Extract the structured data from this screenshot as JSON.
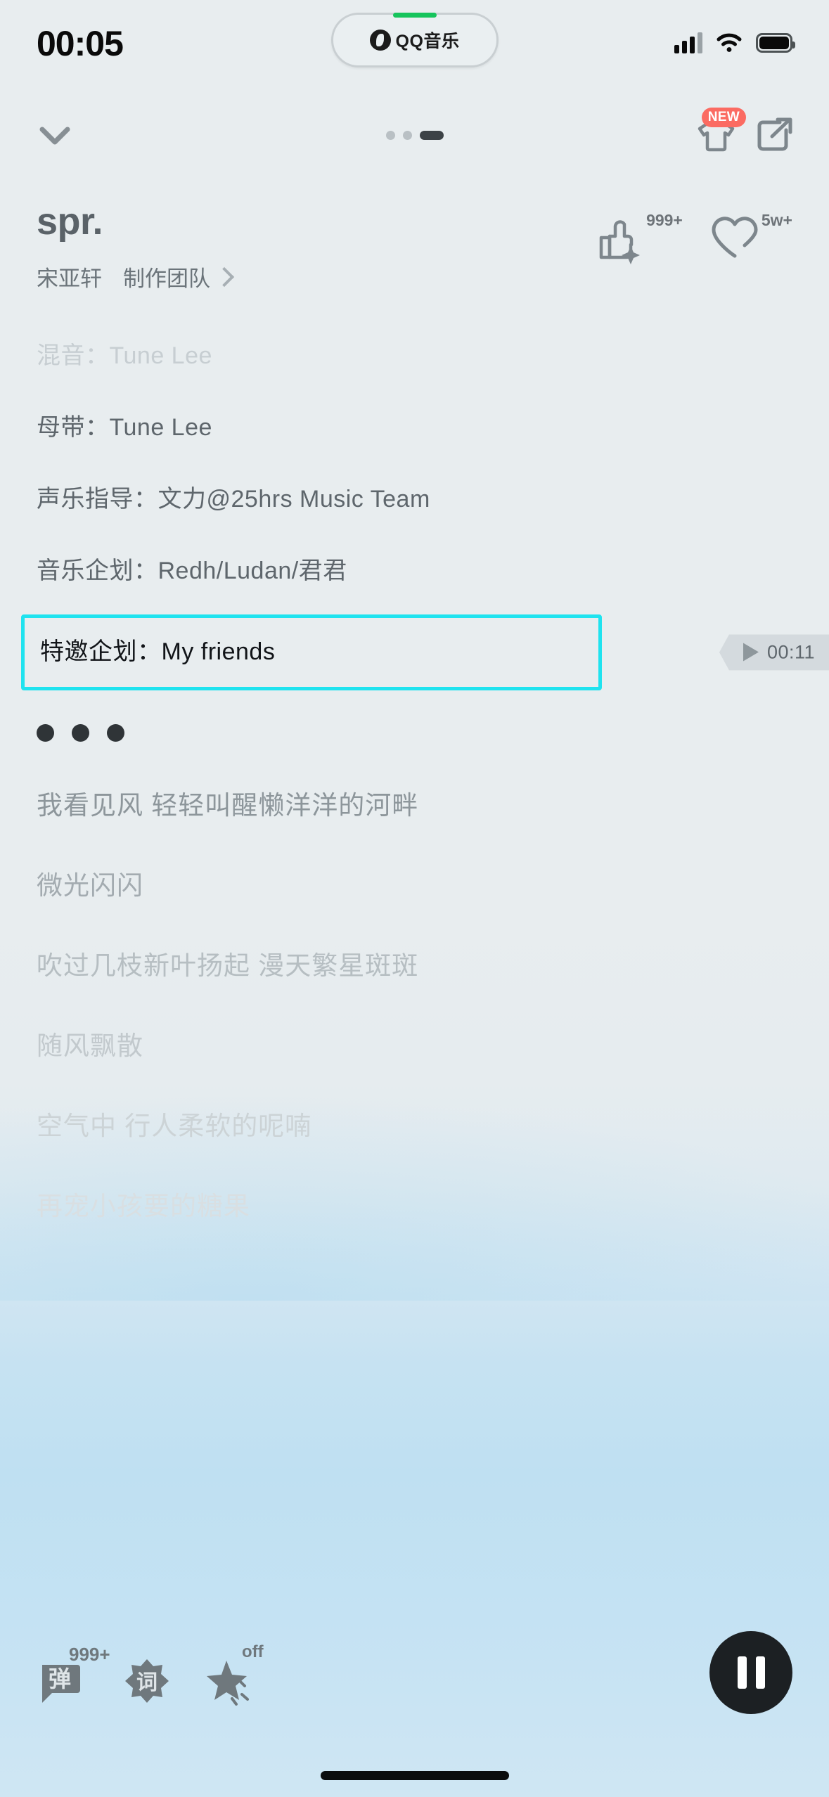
{
  "status_bar": {
    "time": "00:05",
    "dynamic_island_app": "QQ音乐",
    "icons": {
      "signal": "cellular-signal-icon",
      "wifi": "wifi-icon",
      "battery": "battery-icon"
    }
  },
  "nav": {
    "collapse_icon": "chevron-down-icon",
    "page_dots": [
      "dot",
      "dot",
      "dot-active"
    ],
    "skin_icon": "tshirt-icon",
    "skin_badge": "NEW",
    "share_icon": "share-icon"
  },
  "song": {
    "title": "spr.",
    "artist": "宋亚轩",
    "team_label": "制作团队",
    "team_chevron": "chevron-right-icon",
    "like": {
      "icon": "thumbs-up-sparkle-icon",
      "count": "999+"
    },
    "favorite": {
      "icon": "heart-icon",
      "count": "5w+"
    }
  },
  "credits": [
    {
      "label": "混音：",
      "value": "Tune Lee",
      "state": "faded"
    },
    {
      "label": "母带：",
      "value": "Tune Lee",
      "state": "normal"
    },
    {
      "label": "声乐指导：",
      "value": "文力@25hrs Music Team",
      "state": "normal"
    },
    {
      "label": "音乐企划：",
      "value": "Redh/Ludan/君君",
      "state": "normal"
    },
    {
      "label": "特邀企划：",
      "value": "My friends",
      "state": "highlighted"
    }
  ],
  "highlight_color": "#1fe3ef",
  "time_pill": {
    "play_icon": "play-icon",
    "time": "00:11"
  },
  "lyrics": [
    "我看见风 轻轻叫醒懒洋洋的河畔",
    "微光闪闪",
    "吹过几枝新叶扬起 漫天繁星斑斑",
    "随风飘散",
    "空气中 行人柔软的呢喃",
    "再宠小孩要的糖果"
  ],
  "bottom_bar": {
    "danmu": {
      "icon": "danmu-icon",
      "label": "弹",
      "badge": "999+"
    },
    "lyrics_btn": {
      "icon": "lyrics-icon",
      "label": "词"
    },
    "effect": {
      "icon": "star-effect-icon",
      "badge": "off"
    },
    "play_pause": {
      "icon": "pause-icon"
    }
  }
}
